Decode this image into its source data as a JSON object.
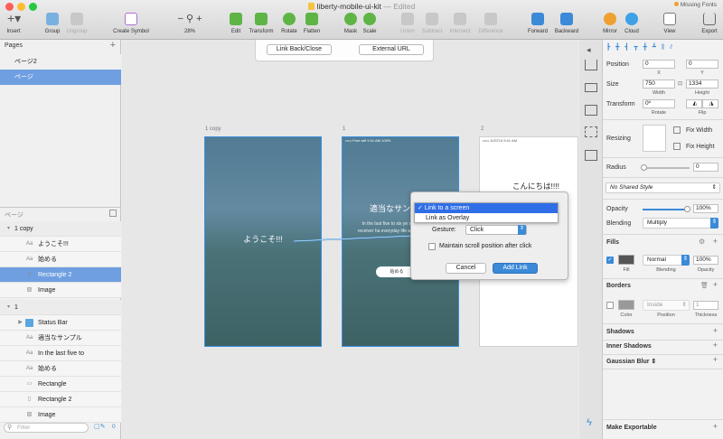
{
  "window": {
    "title": "liberty-mobile-ui-kit",
    "edited": "— Edited",
    "missing_fonts": "Missing Fonts"
  },
  "toolbar": {
    "insert": "Insert",
    "group": "Group",
    "ungroup": "Ungroup",
    "create_symbol": "Create Symbol",
    "zoom": "28%",
    "edit": "Edit",
    "transform": "Transform",
    "rotate": "Rotate",
    "flatten": "Flatten",
    "mask": "Mask",
    "scale": "Scale",
    "union": "Union",
    "subtract": "Subtract",
    "intersect": "Intersect",
    "difference": "Difference",
    "forward": "Forward",
    "backward": "Backward",
    "mirror": "Mirror",
    "cloud": "Cloud",
    "view": "View",
    "export": "Export"
  },
  "pages": {
    "header": "Pages",
    "items": [
      "ページ2",
      "ページ"
    ]
  },
  "layers": {
    "header": "ページ",
    "rows": [
      {
        "label": "1 copy",
        "type": "group"
      },
      {
        "label": "ようこそ!!!",
        "type": "text"
      },
      {
        "label": "始める",
        "type": "text"
      },
      {
        "label": "Rectangle 2",
        "type": "rect"
      },
      {
        "label": "Image",
        "type": "image"
      },
      {
        "label": "1",
        "type": "group"
      },
      {
        "label": "Status Bar",
        "type": "folder"
      },
      {
        "label": "適当なサンプル",
        "type": "text"
      },
      {
        "label": "In the last five to",
        "type": "text"
      },
      {
        "label": "始める",
        "type": "text"
      },
      {
        "label": "Rectangle",
        "type": "shape"
      },
      {
        "label": "Rectangle 2",
        "type": "rect"
      },
      {
        "label": "Image",
        "type": "image"
      }
    ],
    "filter_placeholder": "Filter",
    "count": "0"
  },
  "canvas": {
    "link_back": "Link Back/Close",
    "external_url": "External URL",
    "artboards": [
      {
        "label": "1 copy",
        "text": "ようこそ!!!"
      },
      {
        "label": "1",
        "title": "適当なサン",
        "body": "In the last five to six ye satellite receiver ha everyday life are device",
        "button": "始める",
        "status": "••••• Free wifi   9:41 AM   100%"
      },
      {
        "label": "2",
        "text": "こんにちは!!!!",
        "status": "••••• JUSTUI   9:41 AM"
      }
    ],
    "dropdown": {
      "selected": "Link to a screen",
      "option2": "Link as Overlay",
      "gesture_label": "Gesture:",
      "gesture_value": "Click",
      "checkbox": "Maintain scroll position after click",
      "cancel": "Cancel",
      "add": "Add Link"
    }
  },
  "inspector": {
    "position": "Position",
    "x": "0",
    "y": "0",
    "x_lbl": "X",
    "y_lbl": "Y",
    "size": "Size",
    "w": "750",
    "h": "1334",
    "w_lbl": "Width",
    "h_lbl": "Height",
    "transform": "Transform",
    "rotate_val": "0º",
    "rotate_lbl": "Rotate",
    "flip_lbl": "Flip",
    "resizing": "Resizing",
    "fix_width": "Fix Width",
    "fix_height": "Fix Height",
    "radius": "Radius",
    "radius_val": "0",
    "shared_style": "No Shared Style",
    "opacity": "Opacity",
    "opacity_val": "100%",
    "blending": "Blending",
    "blending_val": "Multiply",
    "fills": "Fills",
    "fill_blend": "Normal",
    "fill_opacity": "100%",
    "fill_lbl": "Fill",
    "blend_lbl": "Blending",
    "opacity_lbl": "Opacity",
    "borders": "Borders",
    "border_pos": "Inside",
    "border_thick": "1",
    "color_lbl": "Color",
    "position_lbl": "Position",
    "thickness_lbl": "Thickness",
    "shadows": "Shadows",
    "inner_shadows": "Inner Shadows",
    "gaussian": "Gaussian Blur",
    "exportable": "Make Exportable"
  }
}
